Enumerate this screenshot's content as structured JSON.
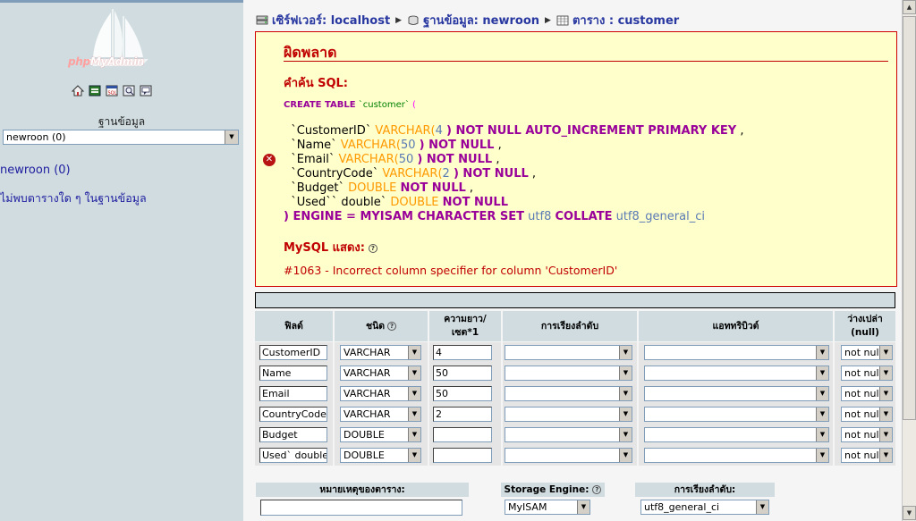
{
  "left": {
    "logo_text_a": "php",
    "logo_text_b": "MyAdmin",
    "icons": [
      "home-icon",
      "query-window-icon",
      "sql-icon",
      "docs-icon",
      "help-icon"
    ],
    "db_label": "ฐานข้อมูล",
    "db_select_value": "newroon (0)",
    "db_link": "newroon (0)",
    "no_tables": "ไม่พบตารางใด ๆ ในฐานข้อมูล"
  },
  "breadcrumb": {
    "server": "เซิร์ฟเวอร์: localhost",
    "database": "ฐานข้อมูล: newroon",
    "table": "ตาราง : customer"
  },
  "error": {
    "title": "ผิดพลาด",
    "sql_label": "คำค้น SQL:",
    "sql_first_kw": "CREATE TABLE",
    "sql_first_id": "`customer`",
    "sql_first_paren": "(",
    "line1_id": "`CustomerID`",
    "line1_type": "VARCHAR(",
    "line1_num": "4",
    "line1_rest": ") NOT NULL AUTO_INCREMENT PRIMARY KEY",
    "line1_end": ",",
    "line2_id": "`Name`",
    "line2_type": "VARCHAR(",
    "line2_num": "50",
    "line2_rest": ") NOT NULL",
    "line2_end": ",",
    "line3_id": "`Email`",
    "line3_type": "VARCHAR(",
    "line3_num": "50",
    "line3_rest": ") NOT NULL",
    "line3_end": ",",
    "line4_id": "`CountryCode`",
    "line4_type": "VARCHAR(",
    "line4_num": "2",
    "line4_rest": ") NOT NULL",
    "line4_end": ",",
    "line5_id": "`Budget`",
    "line5_type": "DOUBLE",
    "line5_rest": "NOT NULL",
    "line5_end": ",",
    "line6_id": "`Used`` double`",
    "line6_type": "DOUBLE",
    "line6_rest": "NOT NULL",
    "line7_kw1": ") ENGINE = MYISAM CHARACTER SET",
    "line7_v1": "utf8",
    "line7_kw2": "COLLATE",
    "line7_v2": "utf8_general_ci",
    "mysql_label": "MySQL แสดง:",
    "message": "#1063 - Incorrect column specifier for column 'CustomerID'"
  },
  "table_headers": {
    "field": "ฟิลด์",
    "type": "ชนิด",
    "length_a": "ความยาว/",
    "length_b": "เซต*1",
    "collation": "การเรียงลำดับ",
    "attributes": "แอททริบิวต์",
    "null_a": "ว่างเปล่า",
    "null_b": "(null)"
  },
  "rows": [
    {
      "field": "CustomerID",
      "type": "VARCHAR",
      "length": "4",
      "collation": "",
      "attribute": "",
      "null": "not null"
    },
    {
      "field": "Name",
      "type": "VARCHAR",
      "length": "50",
      "collation": "",
      "attribute": "",
      "null": "not null"
    },
    {
      "field": "Email",
      "type": "VARCHAR",
      "length": "50",
      "collation": "",
      "attribute": "",
      "null": "not null"
    },
    {
      "field": "CountryCode",
      "type": "VARCHAR",
      "length": "2",
      "collation": "",
      "attribute": "",
      "null": "not null"
    },
    {
      "field": "Budget",
      "type": "DOUBLE",
      "length": "",
      "collation": "",
      "attribute": "",
      "null": "not null"
    },
    {
      "field": "Used` double",
      "type": "DOUBLE",
      "length": "",
      "collation": "",
      "attribute": "",
      "null": "not null"
    }
  ],
  "bottom": {
    "comment_label": "หมายเหตุของตาราง:",
    "comment_value": "",
    "engine_label": "Storage Engine:",
    "engine_value": "MyISAM",
    "collation_label": "การเรียงลำดับ:",
    "collation_value": "utf8_general_ci"
  },
  "colors": {
    "error_red": "#c00000",
    "error_bg": "#ffffcc",
    "header_bg": "#d0dce0",
    "link_blue": "#2838a0"
  }
}
